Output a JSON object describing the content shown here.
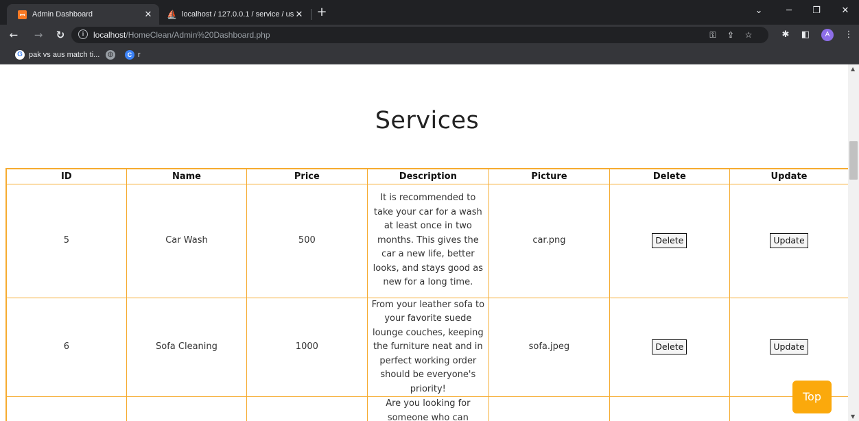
{
  "browser": {
    "tabs": [
      {
        "title": "Admin Dashboard",
        "active": true
      },
      {
        "title": "localhost / 127.0.0.1 / service / us",
        "active": false
      }
    ],
    "url_host": "localhost",
    "url_path": "/HomeClean/Admin%20Dashboard.php",
    "profile_initial": "A",
    "bookmarks": [
      {
        "label": "pak vs aus match ti...",
        "icon": "google-icon"
      },
      {
        "label": "",
        "icon": "globe-icon"
      },
      {
        "label": "r",
        "icon": "c-icon"
      }
    ]
  },
  "page": {
    "title": "Services",
    "top_button": "Top"
  },
  "table": {
    "headers": [
      "ID",
      "Name",
      "Price",
      "Description",
      "Picture",
      "Delete",
      "Update"
    ],
    "rows": [
      {
        "id": "5",
        "name": "Car Wash",
        "price": "500",
        "description": "It is recommended to take your car for a wash at least once in two months. This gives the car a new life, better looks, and stays good as new for a long time.",
        "picture": "car.png",
        "delete": "Delete",
        "update": "Update"
      },
      {
        "id": "6",
        "name": "Sofa Cleaning",
        "price": "1000",
        "description": "From your leather sofa to your favorite suede lounge couches, keeping the furniture neat and in perfect working order should be everyone's priority!",
        "picture": "sofa.jpeg",
        "delete": "Delete",
        "update": "Update"
      },
      {
        "description": "Are you looking for someone who can"
      }
    ]
  },
  "colors": {
    "table_border": "#f6ab2f",
    "top_button_bg": "#fba90c",
    "chrome_dark": "#202124",
    "chrome_toolbar": "#35363a"
  }
}
